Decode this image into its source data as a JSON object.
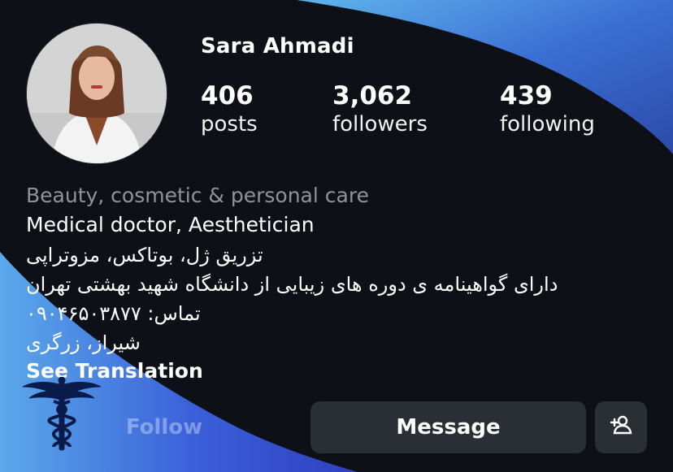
{
  "profile": {
    "username": "Sara Ahmadi",
    "stats": {
      "posts": {
        "value": "406",
        "label": "posts"
      },
      "followers": {
        "value": "3,062",
        "label": "followers"
      },
      "following": {
        "value": "439",
        "label": "following"
      }
    },
    "category": "Beauty, cosmetic & personal care",
    "bio": [
      "Medical doctor, Aesthetician",
      "تزریق ژل، بوتاکس، مزوتراپی",
      "دارای گواهینامه ی دوره های زیبایی از دانشگاه شهید بهشتی تهران",
      "تماس: ۰۹۰۴۶۵۰۳۸۷۷",
      "شیراز، زرگری"
    ],
    "see_translation": "See Translation"
  },
  "actions": {
    "follow": "Follow",
    "message": "Message",
    "add_person_icon": "person-plus-icon"
  },
  "decor": {
    "logo_icon": "caduceus-icon",
    "accent_colors": [
      "#3f6fd8",
      "#2a4fb0",
      "#5fa8e8"
    ]
  }
}
